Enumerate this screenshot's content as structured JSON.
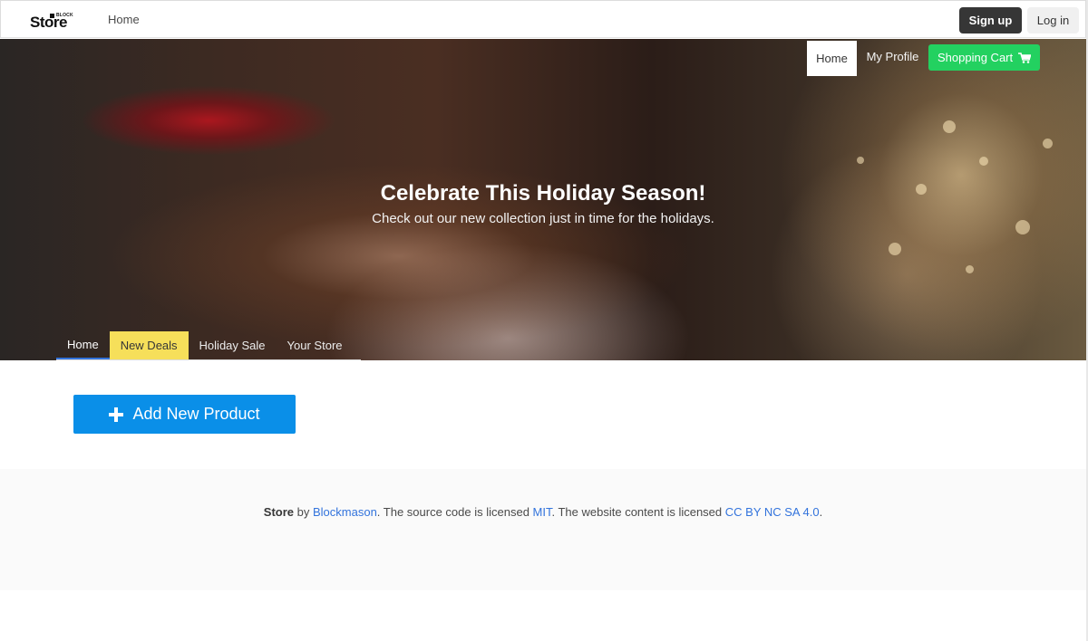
{
  "navbar": {
    "logo_small": "BLOCK",
    "logo_main": "Store",
    "home_label": "Home",
    "signup_label": "Sign up",
    "login_label": "Log in"
  },
  "hero": {
    "title": "Celebrate This Holiday Season!",
    "subtitle": "Check out our new collection just in time for the holidays.",
    "top_tabs": {
      "home": "Home",
      "profile": "My Profile",
      "cart": "Shopping Cart",
      "cart_icon": "shopping-cart-icon",
      "cart_color": "#23d160"
    },
    "bottom_tabs": [
      {
        "label": "Home"
      },
      {
        "label": "New Deals"
      },
      {
        "label": "Holiday Sale"
      },
      {
        "label": "Your Store"
      }
    ],
    "highlight_color": "#f6df5a"
  },
  "main": {
    "add_button_label": "Add New Product",
    "add_button_icon": "plus-icon",
    "add_button_color": "#0a8fe8"
  },
  "footer": {
    "brand": "Store",
    "by": " by ",
    "author": "Blockmason",
    "source_text": ". The source code is licensed ",
    "source_license": "MIT",
    "content_text": ". The website content is licensed ",
    "content_license": "CC BY NC SA 4.0",
    "end": "."
  }
}
